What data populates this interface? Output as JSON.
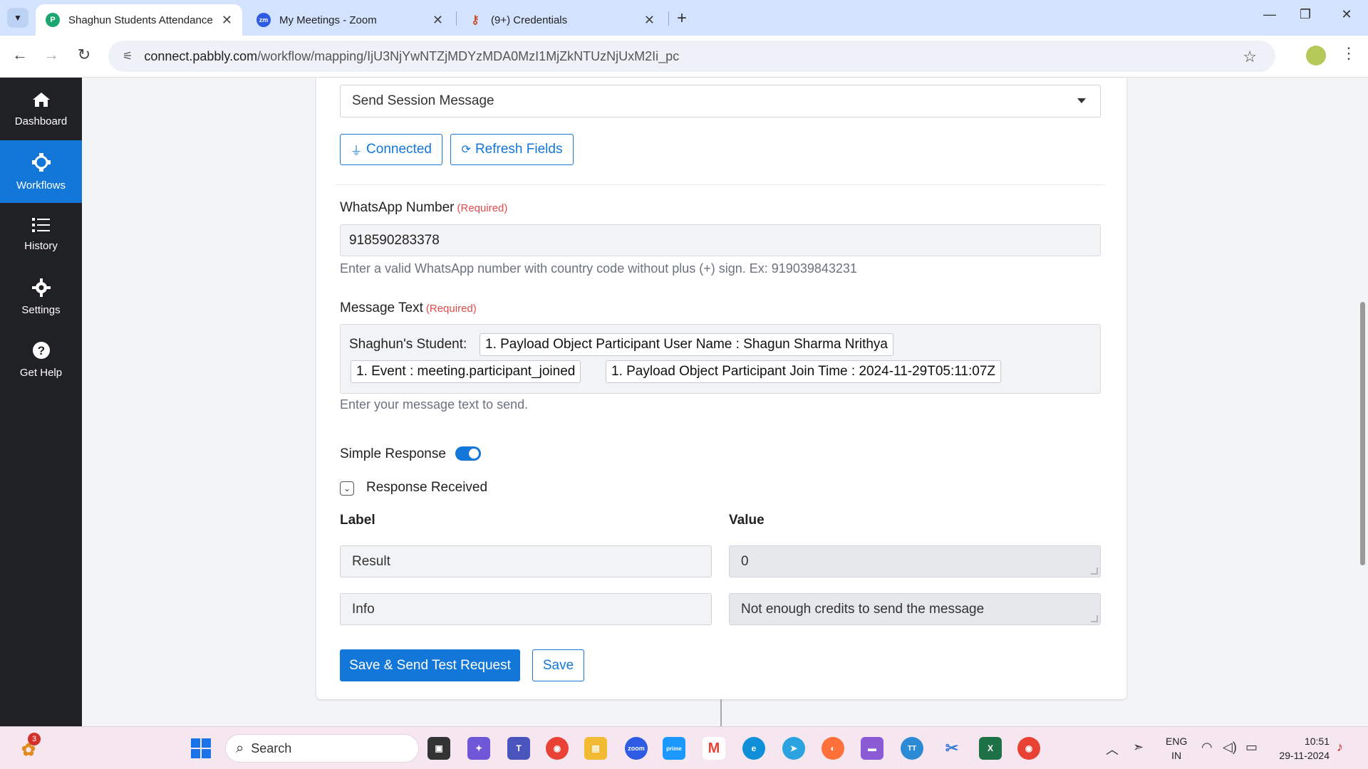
{
  "browser": {
    "tabs": [
      {
        "title": "Shaghun Students Attendance |",
        "favicon_color": "#1ea672",
        "favicon_letter": "P",
        "active": true
      },
      {
        "title": "My Meetings - Zoom",
        "favicon_color": "#2d5be3",
        "favicon_letter": "zm",
        "active": false
      },
      {
        "title": "(9+) Credentials",
        "favicon_color": "#c9522b",
        "favicon_letter": "🔑",
        "active": false
      }
    ],
    "url_host": "connect.pabbly.com",
    "url_path": "/workflow/mapping/IjU3NjYwNTZjMDYzMDA0MzI1MjZkNTUzNjUxM2Ii_pc",
    "new_tab_label": "+"
  },
  "sidebar": {
    "items": [
      {
        "label": "Dashboard",
        "icon": "home-icon",
        "glyph": "⌂",
        "active": false
      },
      {
        "label": "Workflows",
        "icon": "workflows-icon",
        "glyph": "⚙",
        "active": true
      },
      {
        "label": "History",
        "icon": "history-icon",
        "glyph": "☰",
        "active": false
      },
      {
        "label": "Settings",
        "icon": "settings-icon",
        "glyph": "⚙",
        "active": false
      },
      {
        "label": "Get Help",
        "icon": "help-icon",
        "glyph": "?",
        "active": false
      }
    ]
  },
  "form": {
    "action_select": "Send Session Message",
    "connected_label": "Connected",
    "refresh_label": "Refresh Fields",
    "whatsapp": {
      "label": "WhatsApp Number",
      "required": "(Required)",
      "value": "918590283378",
      "help": "Enter a valid WhatsApp number with country code without plus (+) sign. Ex: 919039843231"
    },
    "message": {
      "label": "Message Text",
      "required": "(Required)",
      "prefix": "Shaghun's Student:",
      "chips": [
        "1. Payload Object Participant User Name : Shagun Sharma Nrithya",
        "1. Event : meeting.participant_joined",
        "1. Payload Object Participant Join Time : 2024-11-29T05:11:07Z"
      ],
      "help": "Enter your message text to send."
    },
    "simple_response_label": "Simple Response",
    "simple_response_on": true,
    "response_received_label": "Response Received",
    "table": {
      "label_header": "Label",
      "value_header": "Value",
      "rows": [
        {
          "label": "Result",
          "value": "0"
        },
        {
          "label": "Info",
          "value": "Not enough credits to send the message"
        }
      ]
    },
    "save_send_label": "Save & Send Test Request",
    "save_label": "Save"
  },
  "taskbar": {
    "search_placeholder": "Search",
    "notification_count": "3",
    "lang_line1": "ENG",
    "lang_line2": "IN",
    "time": "10:51",
    "date": "29-11-2024"
  },
  "colors": {
    "accent": "#1277d8",
    "sidebar_bg": "#202124",
    "required": "#e34b4b"
  }
}
